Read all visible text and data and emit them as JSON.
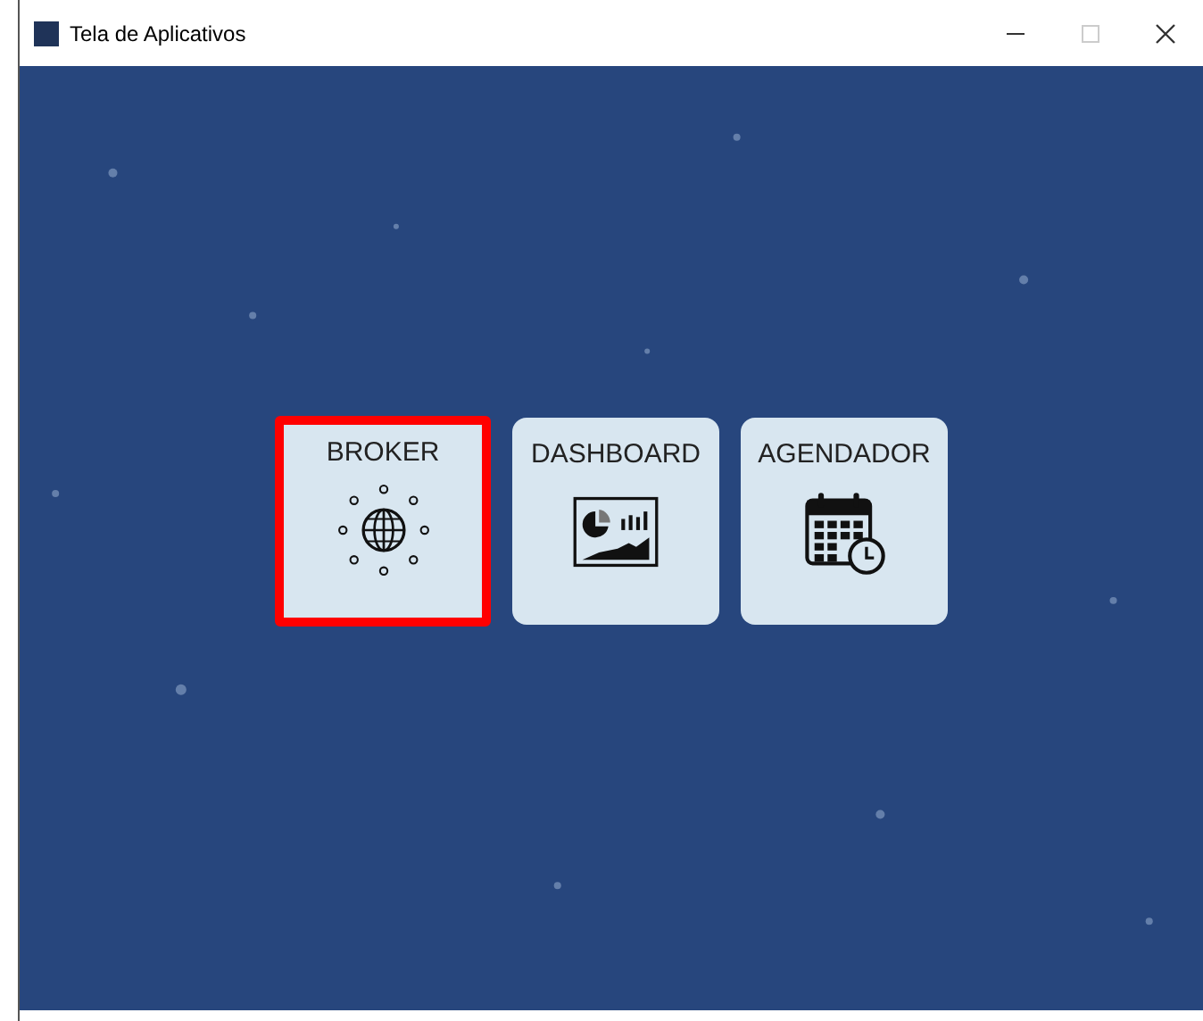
{
  "window": {
    "title": "Tela de Aplicativos"
  },
  "apps": [
    {
      "label": "BROKER",
      "kind": "network",
      "selected": true
    },
    {
      "label": "DASHBOARD",
      "kind": "dashboard",
      "selected": false
    },
    {
      "label": "AGENDADOR",
      "kind": "calendar",
      "selected": false
    }
  ]
}
